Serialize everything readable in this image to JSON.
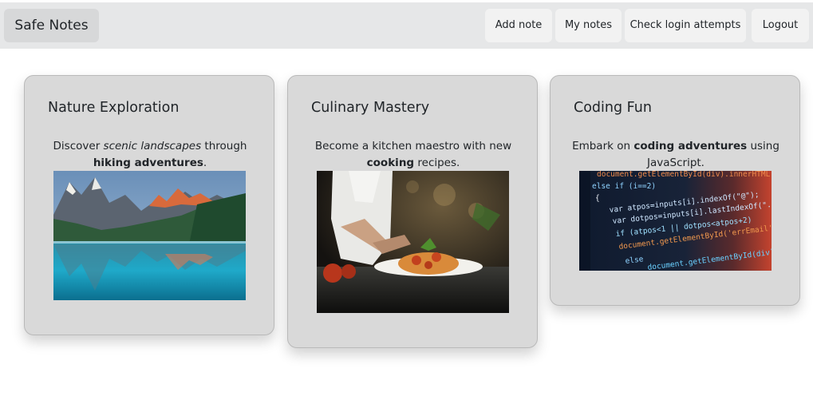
{
  "navbar": {
    "brand": "Safe Notes",
    "buttons": {
      "add_note": "Add note",
      "my_notes": "My notes",
      "check_login": "Check login attempts",
      "logout": "Logout"
    }
  },
  "cards": [
    {
      "title": "Nature Exploration",
      "text_pre": "Discover ",
      "text_em": "scenic landscapes",
      "text_mid": " through ",
      "text_strong": "hiking adventures",
      "text_post": ".",
      "image": "mountain-lake-photo"
    },
    {
      "title": "Culinary Mastery",
      "text_pre": "Become a kitchen maestro with new ",
      "text_strong": "cooking",
      "text_post": " recipes.",
      "image": "chef-pasta-photo"
    },
    {
      "title": "Coding Fun",
      "text_pre": "Embark on ",
      "text_strong": "coding adventures",
      "text_post": " using JavaScript.",
      "image": "code-screen-photo",
      "code_lines": [
        "document.getElementById(div).innerHTML",
        "else if (i==2)",
        "{",
        "var atpos=inputs[i].indexOf(\"@\");",
        "var dotpos=inputs[i].lastIndexOf(\".\");",
        "if (atpos<1 || dotpos<atpos+2)",
        "document.getElementById('errEmail')",
        "else",
        "document.getElementById(div).innerHTML"
      ]
    }
  ]
}
